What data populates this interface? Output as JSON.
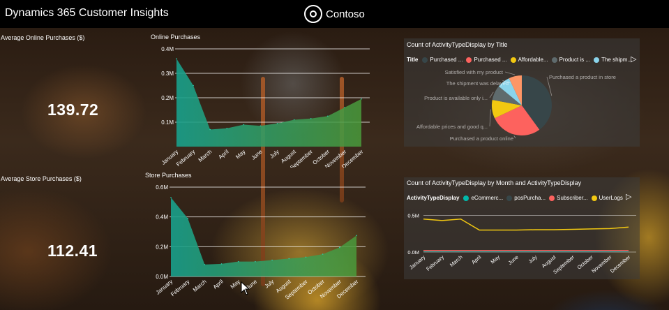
{
  "app": {
    "title": "Dynamics 365 Customer Insights",
    "brand": "Contoso"
  },
  "kpis": [
    {
      "label": "Average Online Purchases ($)",
      "value": "139.72"
    },
    {
      "label": "Average Store Purchases ($)",
      "value": "112.41"
    }
  ],
  "colors": {
    "teal_area": "#18a08c",
    "green_area": "#4a9a3a",
    "line_yellow": "#f2c811",
    "line_red": "#fd625e",
    "line_teal": "#01b8aa"
  },
  "chart_data": [
    {
      "type": "area",
      "title": "Online Purchases",
      "categories": [
        "January",
        "February",
        "March",
        "April",
        "May",
        "June",
        "July",
        "August",
        "September",
        "October",
        "November",
        "December"
      ],
      "values": [
        360000,
        250000,
        70000,
        75000,
        90000,
        85000,
        95000,
        110000,
        115000,
        125000,
        160000,
        195000
      ],
      "y_ticks": [
        "0.1M",
        "0.2M",
        "0.3M",
        "0.4M"
      ],
      "ylim": [
        0,
        400000
      ],
      "grid": true
    },
    {
      "type": "area",
      "title": "Store Purchases",
      "categories": [
        "January",
        "February",
        "March",
        "April",
        "May",
        "June",
        "July",
        "August",
        "September",
        "October",
        "November",
        "December"
      ],
      "values": [
        530000,
        390000,
        80000,
        85000,
        100000,
        100000,
        110000,
        120000,
        130000,
        150000,
        195000,
        275000
      ],
      "y_ticks": [
        "0.0M",
        "0.2M",
        "0.4M",
        "0.6M"
      ],
      "ylim": [
        0,
        600000
      ],
      "grid": true
    },
    {
      "type": "pie",
      "title": "Count of ActivityTypeDisplay by Title",
      "legend_title": "Title",
      "legend": [
        {
          "name": "Purchased ...",
          "color": "#374649"
        },
        {
          "name": "Purchased ...",
          "color": "#fd625e"
        },
        {
          "name": "Affordable...",
          "color": "#f2c811"
        },
        {
          "name": "Product is ...",
          "color": "#5f6b6d"
        },
        {
          "name": "The shipm...",
          "color": "#8ad4eb"
        }
      ],
      "slices": [
        {
          "label": "Purchased a product in store",
          "value": 40,
          "color": "#374649"
        },
        {
          "label": "Purchased a product online",
          "value": 28,
          "color": "#fd625e"
        },
        {
          "label": "Affordable prices and good q...",
          "value": 10,
          "color": "#f2c811"
        },
        {
          "label": "Product is available only i...",
          "value": 8,
          "color": "#5f6b6d"
        },
        {
          "label": "The shipment was delayed",
          "value": 7,
          "color": "#8ad4eb"
        },
        {
          "label": "Satisfied with my product",
          "value": 7,
          "color": "#fe9666"
        }
      ]
    },
    {
      "type": "line",
      "title": "Count of ActivityTypeDisplay by Month and ActivityTypeDisplay",
      "legend_title": "ActivityTypeDisplay",
      "legend": [
        {
          "name": "eCommerc...",
          "color": "#01b8aa"
        },
        {
          "name": "posPurcha...",
          "color": "#374649"
        },
        {
          "name": "Subscriber...",
          "color": "#fd625e"
        },
        {
          "name": "UserLogs",
          "color": "#f2c811"
        }
      ],
      "categories": [
        "January",
        "February",
        "March",
        "April",
        "May",
        "June",
        "July",
        "August",
        "September",
        "October",
        "November",
        "December"
      ],
      "series": [
        {
          "name": "eCommerc...",
          "color": "#01b8aa",
          "values": [
            10000,
            10000,
            10000,
            10000,
            10000,
            10000,
            10000,
            10000,
            10000,
            10000,
            10000,
            10000
          ]
        },
        {
          "name": "posPurcha...",
          "color": "#374649",
          "values": [
            15000,
            15000,
            15000,
            15000,
            15000,
            15000,
            15000,
            15000,
            15000,
            15000,
            15000,
            15000
          ]
        },
        {
          "name": "Subscriber...",
          "color": "#fd625e",
          "values": [
            20000,
            20000,
            20000,
            20000,
            20000,
            20000,
            20000,
            20000,
            20000,
            20000,
            20000,
            20000
          ]
        },
        {
          "name": "UserLogs",
          "color": "#f2c811",
          "values": [
            450000,
            430000,
            450000,
            300000,
            300000,
            300000,
            305000,
            305000,
            310000,
            315000,
            320000,
            340000
          ]
        }
      ],
      "y_ticks": [
        "0.0M",
        "0.5M"
      ],
      "ylim": [
        0,
        600000
      ],
      "grid": true
    }
  ]
}
